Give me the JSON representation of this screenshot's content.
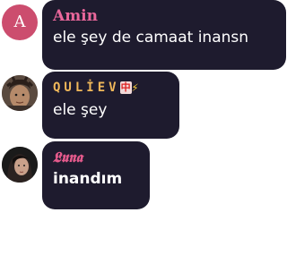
{
  "messages": [
    {
      "avatar_initial": "A",
      "avatar_color": "#cc4d6e",
      "author": "Amin",
      "author_color": "#e9679b",
      "text": "ele şey de camaat inansn"
    },
    {
      "avatar_type": "photo",
      "author": "QULİEV",
      "author_badge": "中",
      "author_icon": "lightning-bolt",
      "author_color": "#f0b85a",
      "text": "ele şey"
    },
    {
      "avatar_type": "photo",
      "author": "𝕷𝖚𝖓𝖆",
      "author_color": "#e45a8c",
      "text": "inandım"
    }
  ],
  "bubble_color": "#1e1b2e"
}
